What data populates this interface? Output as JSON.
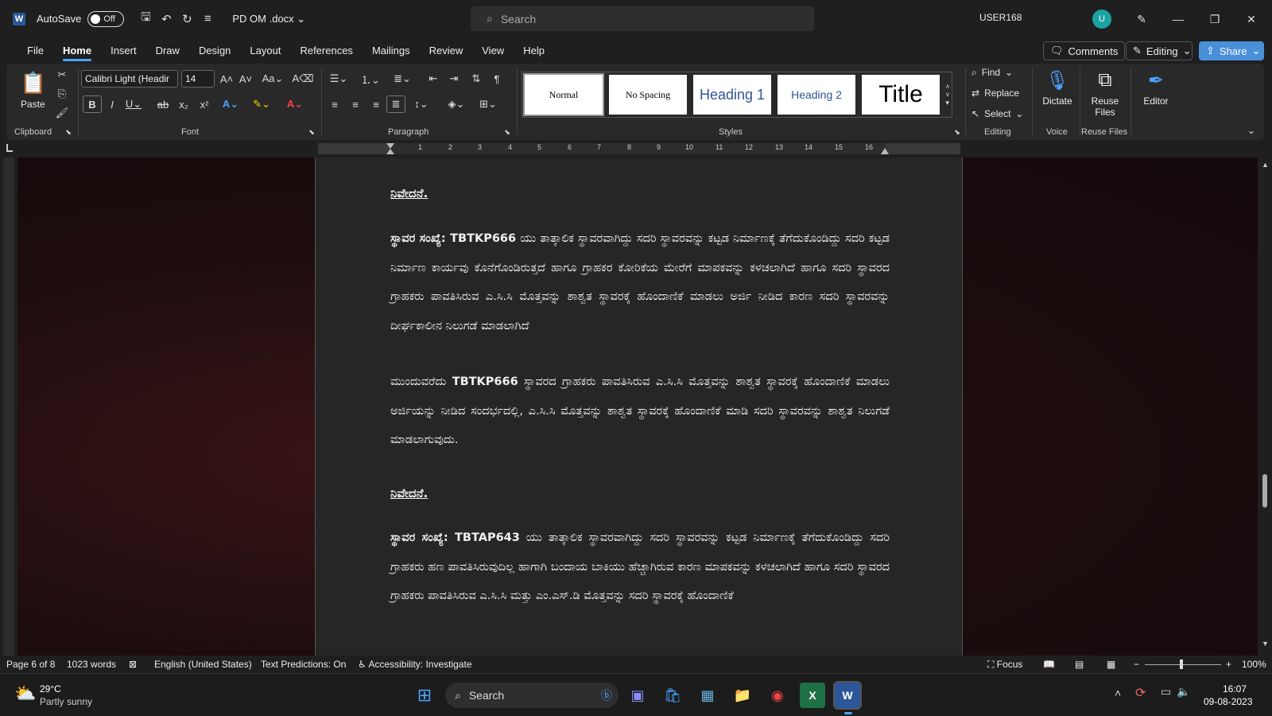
{
  "titlebar": {
    "autosave_label": "AutoSave",
    "toggle_state": "Off",
    "doc_name": "PD OM .docx",
    "search_placeholder": "Search",
    "user": "USER168",
    "avatar": "U"
  },
  "tabs": [
    "File",
    "Home",
    "Insert",
    "Draw",
    "Design",
    "Layout",
    "References",
    "Mailings",
    "Review",
    "View",
    "Help"
  ],
  "ribbon_right": {
    "comments": "Comments",
    "editing": "Editing",
    "share": "Share"
  },
  "font": {
    "name": "Calibri Light (Headir",
    "size": "14"
  },
  "styles": [
    "Normal",
    "No Spacing",
    "Heading 1",
    "Heading 2",
    "Title"
  ],
  "editing": {
    "find": "Find",
    "replace": "Replace",
    "select": "Select"
  },
  "voice": {
    "dictate": "Dictate"
  },
  "reuse": {
    "label": "Reuse Files"
  },
  "editor": {
    "label": "Editor"
  },
  "groups": {
    "clipboard": "Clipboard",
    "font": "Font",
    "paragraph": "Paragraph",
    "styles": "Styles",
    "editing": "Editing",
    "voice": "Voice",
    "reuse": "Reuse Files"
  },
  "paste_label": "Paste",
  "ruler": [
    "1",
    "2",
    "3",
    "4",
    "5",
    "6",
    "7",
    "8",
    "9",
    "10",
    "11",
    "12",
    "13",
    "14",
    "15",
    "16"
  ],
  "doc": {
    "h1": "ನಿವೇದನೆ.",
    "p1a_bold": "ಸ್ಥಾವರ ಸಂಖ್ಯೆ: TBTKP666",
    "p1a": " ಯು ತಾತ್ಕಾಲಿಕ ಸ್ಥಾವರವಾಗಿದ್ದು ಸದರಿ ಸ್ಥಾವರವನ್ನು ಕಟ್ಟಡ ನಿರ್ಮಾಣಕ್ಕೆ ತೆಗೆದುಕೊಂಡಿದ್ದು ಸದರಿ ಕಟ್ಟಡ ನಿರ್ಮಾಣ ಕಾರ್ಯವು ಕೊನೆಗೊಂಡಿರುತ್ತದೆ ಹಾಗೂ ಗ್ರಾಹಕರ ಕೋರಿಕೆಯ ಮೇರೆಗೆ ಮಾಪಕವನ್ನು ಕಳಚಲಾಗಿದೆ ಹಾಗೂ ಸದರಿ ಸ್ಥಾವರದ ಗ್ರಾಹಕರು ಪಾವತಿಸಿರುವ ಎ.ಸಿ.ಸಿ ಮೊತ್ತವನ್ನು ಶಾಶ್ವತ ಸ್ಥಾವರಕ್ಕೆ ಹೊಂದಾಣಿಕೆ ಮಾಡಲು ಅರ್ಜಿ ನೀಡಿದ ಕಾರಣ ಸದರಿ ಸ್ಥಾವರವನ್ನು ದೀರ್ಘಕಾಲೀನ ನಿಲುಗಡೆ ಮಾಡಲಾಗಿದೆ",
    "p2_pre": "ಮುಂದುವರೆದು ",
    "p2_bold": "TBTKP666",
    "p2": " ಸ್ಥಾವರದ ಗ್ರಾಹಕರು ಪಾವತಿಸಿರುವ ಎ.ಸಿ.ಸಿ ಮೊತ್ತವನ್ನು ಶಾಶ್ವತ ಸ್ಥಾವರಕ್ಕೆ ಹೊಂದಾಣಿಕೆ ಮಾಡಲು ಅರ್ಜಿಯನ್ನು ನೀಡಿದ ಸಂದರ್ಭದಲ್ಲಿ, ಎ.ಸಿ.ಸಿ ಮೊತ್ತವನ್ನು ಶಾಶ್ವತ ಸ್ಥಾವರಕ್ಕೆ ಹೊಂದಾಣಿಕೆ ಮಾಡಿ ಸದರಿ ಸ್ಥಾವರವನ್ನು ಶಾಶ್ವತ ನಿಲುಗಡೆ ಮಾಡಲಾಗುವುದು.",
    "h2": "ನಿವೇದನೆ.",
    "p3_bold": "ಸ್ಥಾವರ ಸಂಖ್ಯೆ: TBTAP643",
    "p3": " ಯು ತಾತ್ಕಾಲಿಕ ಸ್ಥಾವರವಾಗಿದ್ದು ಸದರಿ ಸ್ಥಾವರವನ್ನು ಕಟ್ಟಡ ನಿರ್ಮಾಣಕ್ಕೆ ತೆಗೆದುಕೊಂಡಿದ್ದು ಸದರಿ ಗ್ರಾಹಕರು ಹಣ ಪಾವತಿಸಿರುವುದಿಲ್ಲ ಹಾಗಾಗಿ ಬಂದಾಯ ಬಾಕಿಯು ಹೆಚ್ಚಾಗಿರುವ ಕಾರಣ ಮಾಪಕವನ್ನು ಕಳಚಲಾಗಿದೆ ಹಾಗೂ ಸದರಿ ಸ್ಥಾವರದ ಗ್ರಾಹಕರು ಪಾವತಿಸಿರುವ ಎ.ಸಿ.ಸಿ ಮತ್ತು ಎಂ.ಎಸ್.ಡಿ ಮೊತ್ತವನ್ನು ಸದರಿ ಸ್ಥಾವರಕ್ಕೆ ಹೊಂದಾಣಿಕೆ"
  },
  "status": {
    "page": "Page 6 of 8",
    "words": "1023 words",
    "language": "English (United States)",
    "predictions": "Text Predictions: On",
    "accessibility": "Accessibility: Investigate",
    "focus": "Focus",
    "zoom": "100%"
  },
  "taskbar": {
    "temp": "29°C",
    "weather": "Partly sunny",
    "search": "Search",
    "time": "16:07",
    "date": "09-08-2023"
  }
}
